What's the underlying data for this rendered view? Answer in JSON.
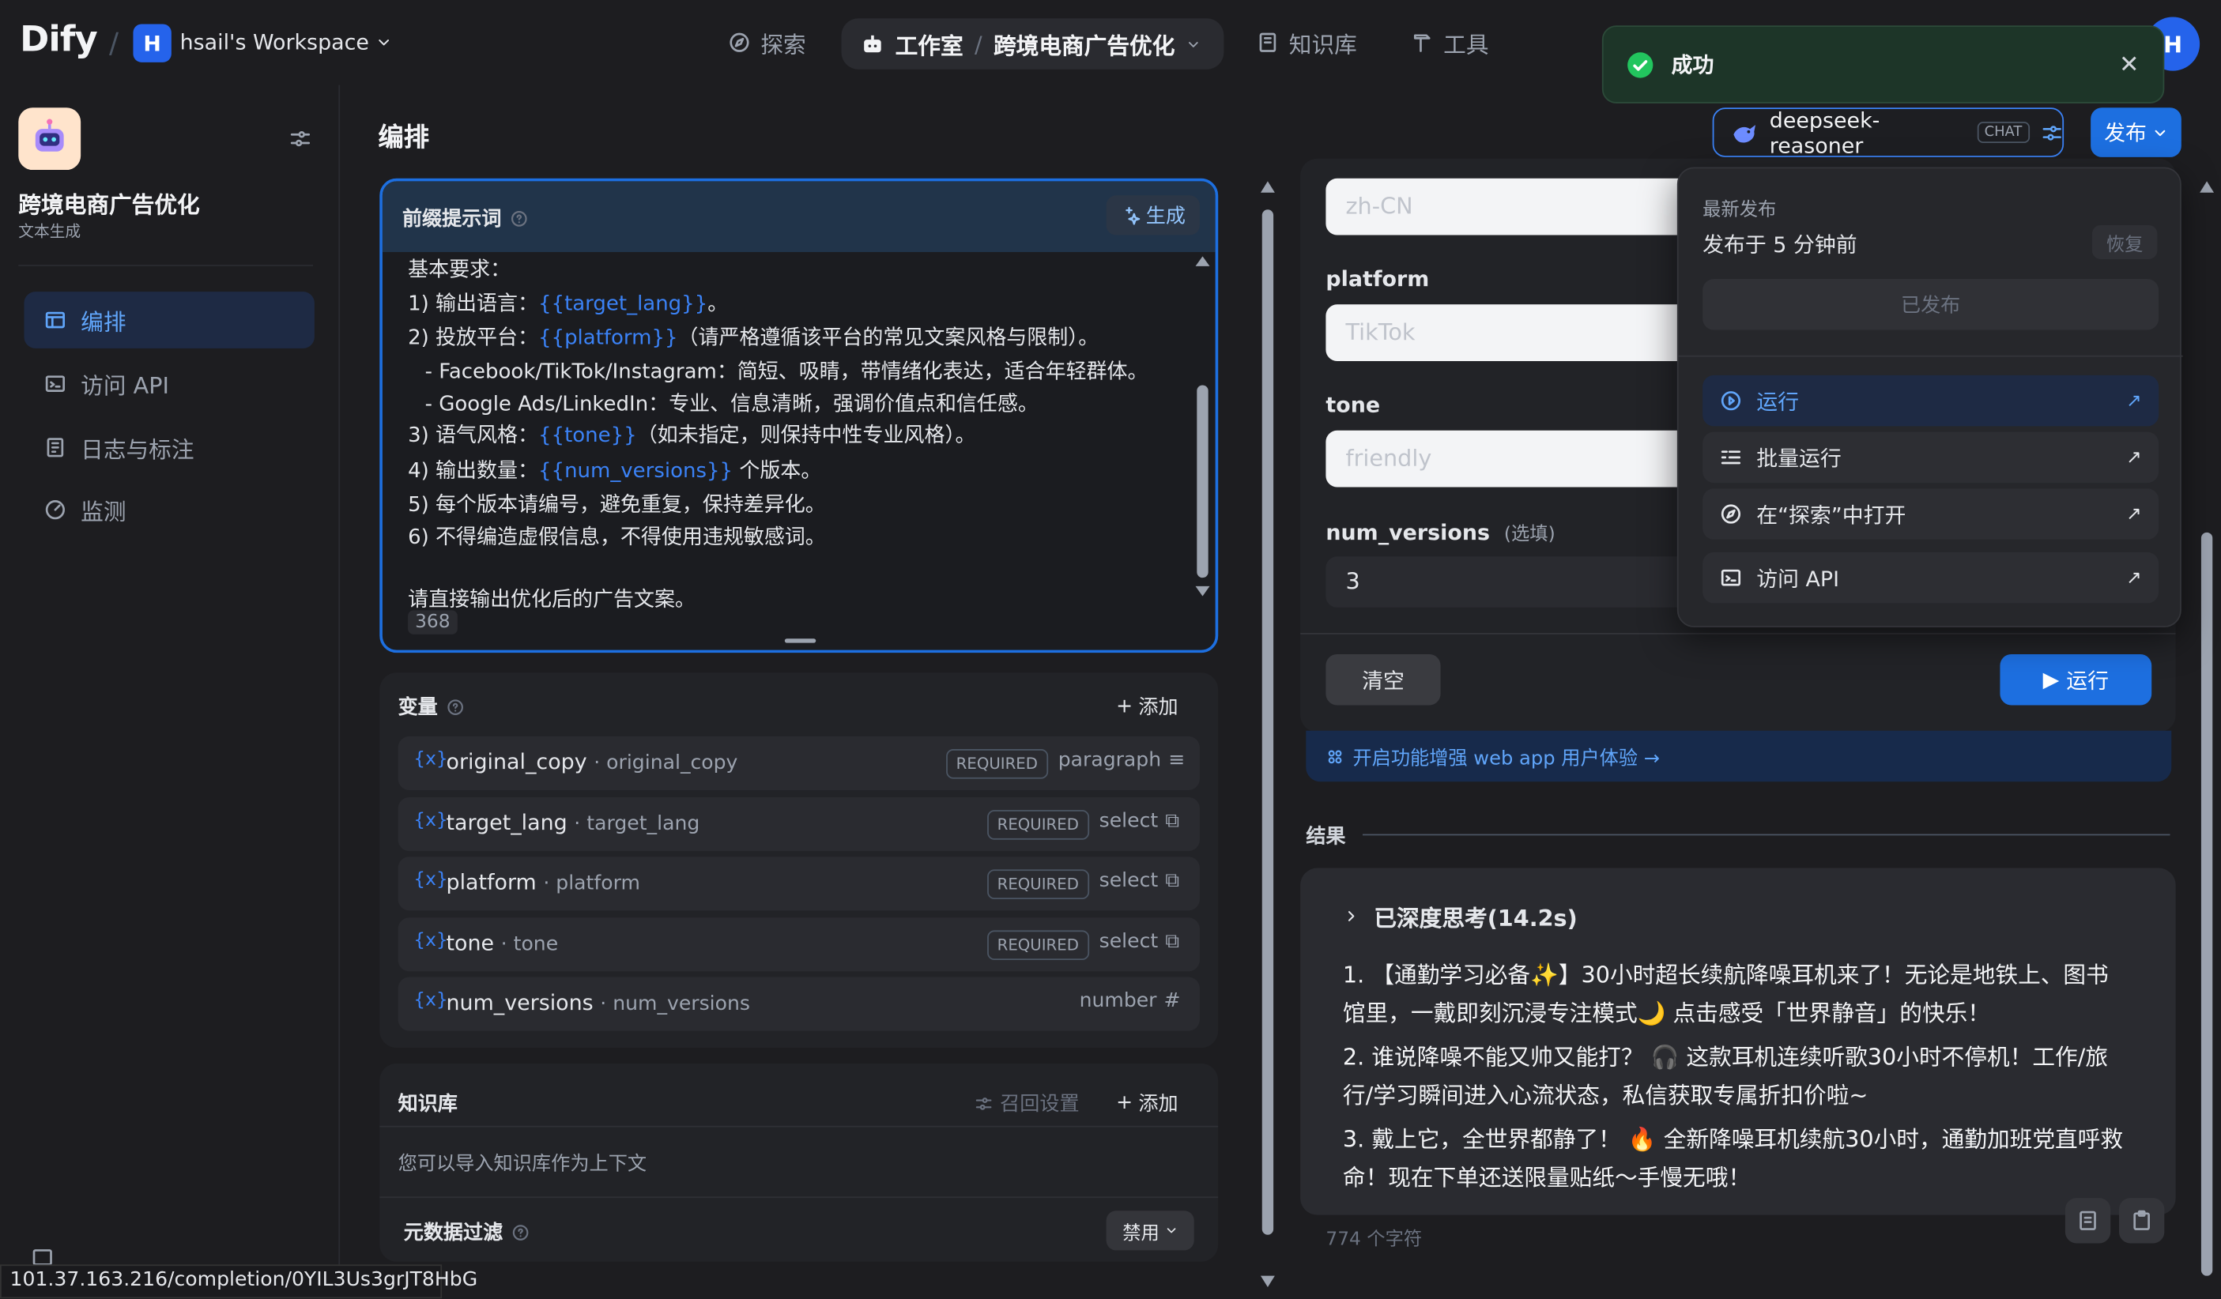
{
  "header": {
    "logo": "Dify",
    "workspace_initial": "H",
    "workspace_name": "hsail's Workspace",
    "nav": {
      "explore": "探索",
      "studio": "工作室",
      "studio_app": "跨境电商广告优化",
      "knowledge": "知识库",
      "tools": "工具"
    },
    "avatar_initial": "H"
  },
  "toast": {
    "message": "成功"
  },
  "sidebar": {
    "app_name": "跨境电商广告优化",
    "app_type": "文本生成",
    "items": [
      {
        "label": "编排",
        "icon": "layout-icon",
        "active": true
      },
      {
        "label": "访问 API",
        "icon": "terminal-icon",
        "active": false
      },
      {
        "label": "日志与标注",
        "icon": "file-text-icon",
        "active": false
      },
      {
        "label": "监测",
        "icon": "gauge-icon",
        "active": false
      }
    ]
  },
  "url_status": "101.37.163.216/completion/0YIL3Us3grJT8HbG",
  "orchestrate": {
    "title": "编排",
    "prompt": {
      "title": "前缀提示词",
      "generate_label": "生成",
      "lines": [
        {
          "pre": "基本要求：",
          "var": "",
          "post": ""
        },
        {
          "pre": "1) 输出语言：",
          "var": "{{target_lang}}",
          "post": "。"
        },
        {
          "pre": "2) 投放平台：",
          "var": "{{platform}}",
          "post": "（请严格遵循该平台的常见文案风格与限制）。"
        },
        {
          "pre": "   - Facebook/TikTok/Instagram：简短、吸睛，带情绪化表达，适合年轻群体。",
          "var": "",
          "post": ""
        },
        {
          "pre": "   - Google Ads/LinkedIn：专业、信息清晰，强调价值点和信任感。",
          "var": "",
          "post": ""
        },
        {
          "pre": "3) 语气风格：",
          "var": "{{tone}}",
          "post": "（如未指定，则保持中性专业风格）。"
        },
        {
          "pre": "4) 输出数量：",
          "var": "{{num_versions}}",
          "post": " 个版本。"
        },
        {
          "pre": "5) 每个版本请编号，避免重复，保持差异化。",
          "var": "",
          "post": ""
        },
        {
          "pre": "6) 不得编造虚假信息，不得使用违规敏感词。",
          "var": "",
          "post": ""
        },
        {
          "pre": "",
          "var": "",
          "post": ""
        },
        {
          "pre": "请直接输出优化后的广告文案。",
          "var": "",
          "post": ""
        }
      ],
      "char_count": "368"
    },
    "variables": {
      "title": "变量",
      "add_label": "添加",
      "rows": [
        {
          "key": "original_copy",
          "name": "original_copy",
          "required": "REQUIRED",
          "type": "paragraph"
        },
        {
          "key": "target_lang",
          "name": "target_lang",
          "required": "REQUIRED",
          "type": "select"
        },
        {
          "key": "platform",
          "name": "platform",
          "required": "REQUIRED",
          "type": "select"
        },
        {
          "key": "tone",
          "name": "tone",
          "required": "REQUIRED",
          "type": "select"
        },
        {
          "key": "num_versions",
          "name": "num_versions",
          "required": "",
          "type": "number"
        }
      ]
    },
    "knowledge": {
      "title": "知识库",
      "recall_label": "召回设置",
      "add_label": "添加",
      "hint": "您可以导入知识库作为上下文",
      "filter_title": "元数据过滤",
      "filter_value": "禁用"
    }
  },
  "model": {
    "name": "deepseek-reasoner",
    "tag": "CHAT"
  },
  "publish": {
    "label": "发布",
    "menu": {
      "latest_label": "最新发布",
      "published_time": "发布于 5 分钟前",
      "restore_label": "恢复",
      "published_label": "已发布",
      "items": [
        {
          "label": "运行",
          "icon": "play-circle-icon",
          "active": true
        },
        {
          "label": "批量运行",
          "icon": "batch-icon",
          "active": false
        },
        {
          "label": "在“探索”中打开",
          "icon": "compass-icon",
          "active": false
        },
        {
          "label": "访问 API",
          "icon": "terminal-icon",
          "active": false
        }
      ]
    }
  },
  "debug": {
    "fields": [
      {
        "label": "",
        "placeholder": "zh-CN"
      },
      {
        "label": "platform",
        "placeholder": "TikTok"
      },
      {
        "label": "tone",
        "placeholder": "friendly"
      },
      {
        "label": "num_versions",
        "optional": "(选填)",
        "value": "3"
      }
    ],
    "clear_label": "清空",
    "run_label": "运行",
    "webapp_hint": "开启功能增强 web app 用户体验 →",
    "result_label": "结果",
    "thinking": "已深度思考(14.2s)",
    "result_lines": [
      "1. 【通勤学习必备✨】30小时超长续航降噪耳机来了！无论是地铁上、图书",
      "    馆里，一戴即刻沉浸专注模式🌙 点击感受「世界静音」的快乐！",
      "2. 谁说降噪不能又帅又能打？ 🎧 这款耳机连续听歌30小时不停机！工作/旅",
      "    行/学习瞬间进入心流状态，私信获取专属折扣价啦~",
      "3. 戴上它，全世界都静了！ 🔥 全新降噪耳机续航30小时，通勤加班党直呼救",
      "    命！现在下单还送限量贴纸～手慢无哦！"
    ],
    "char_count": "774 个字符"
  }
}
